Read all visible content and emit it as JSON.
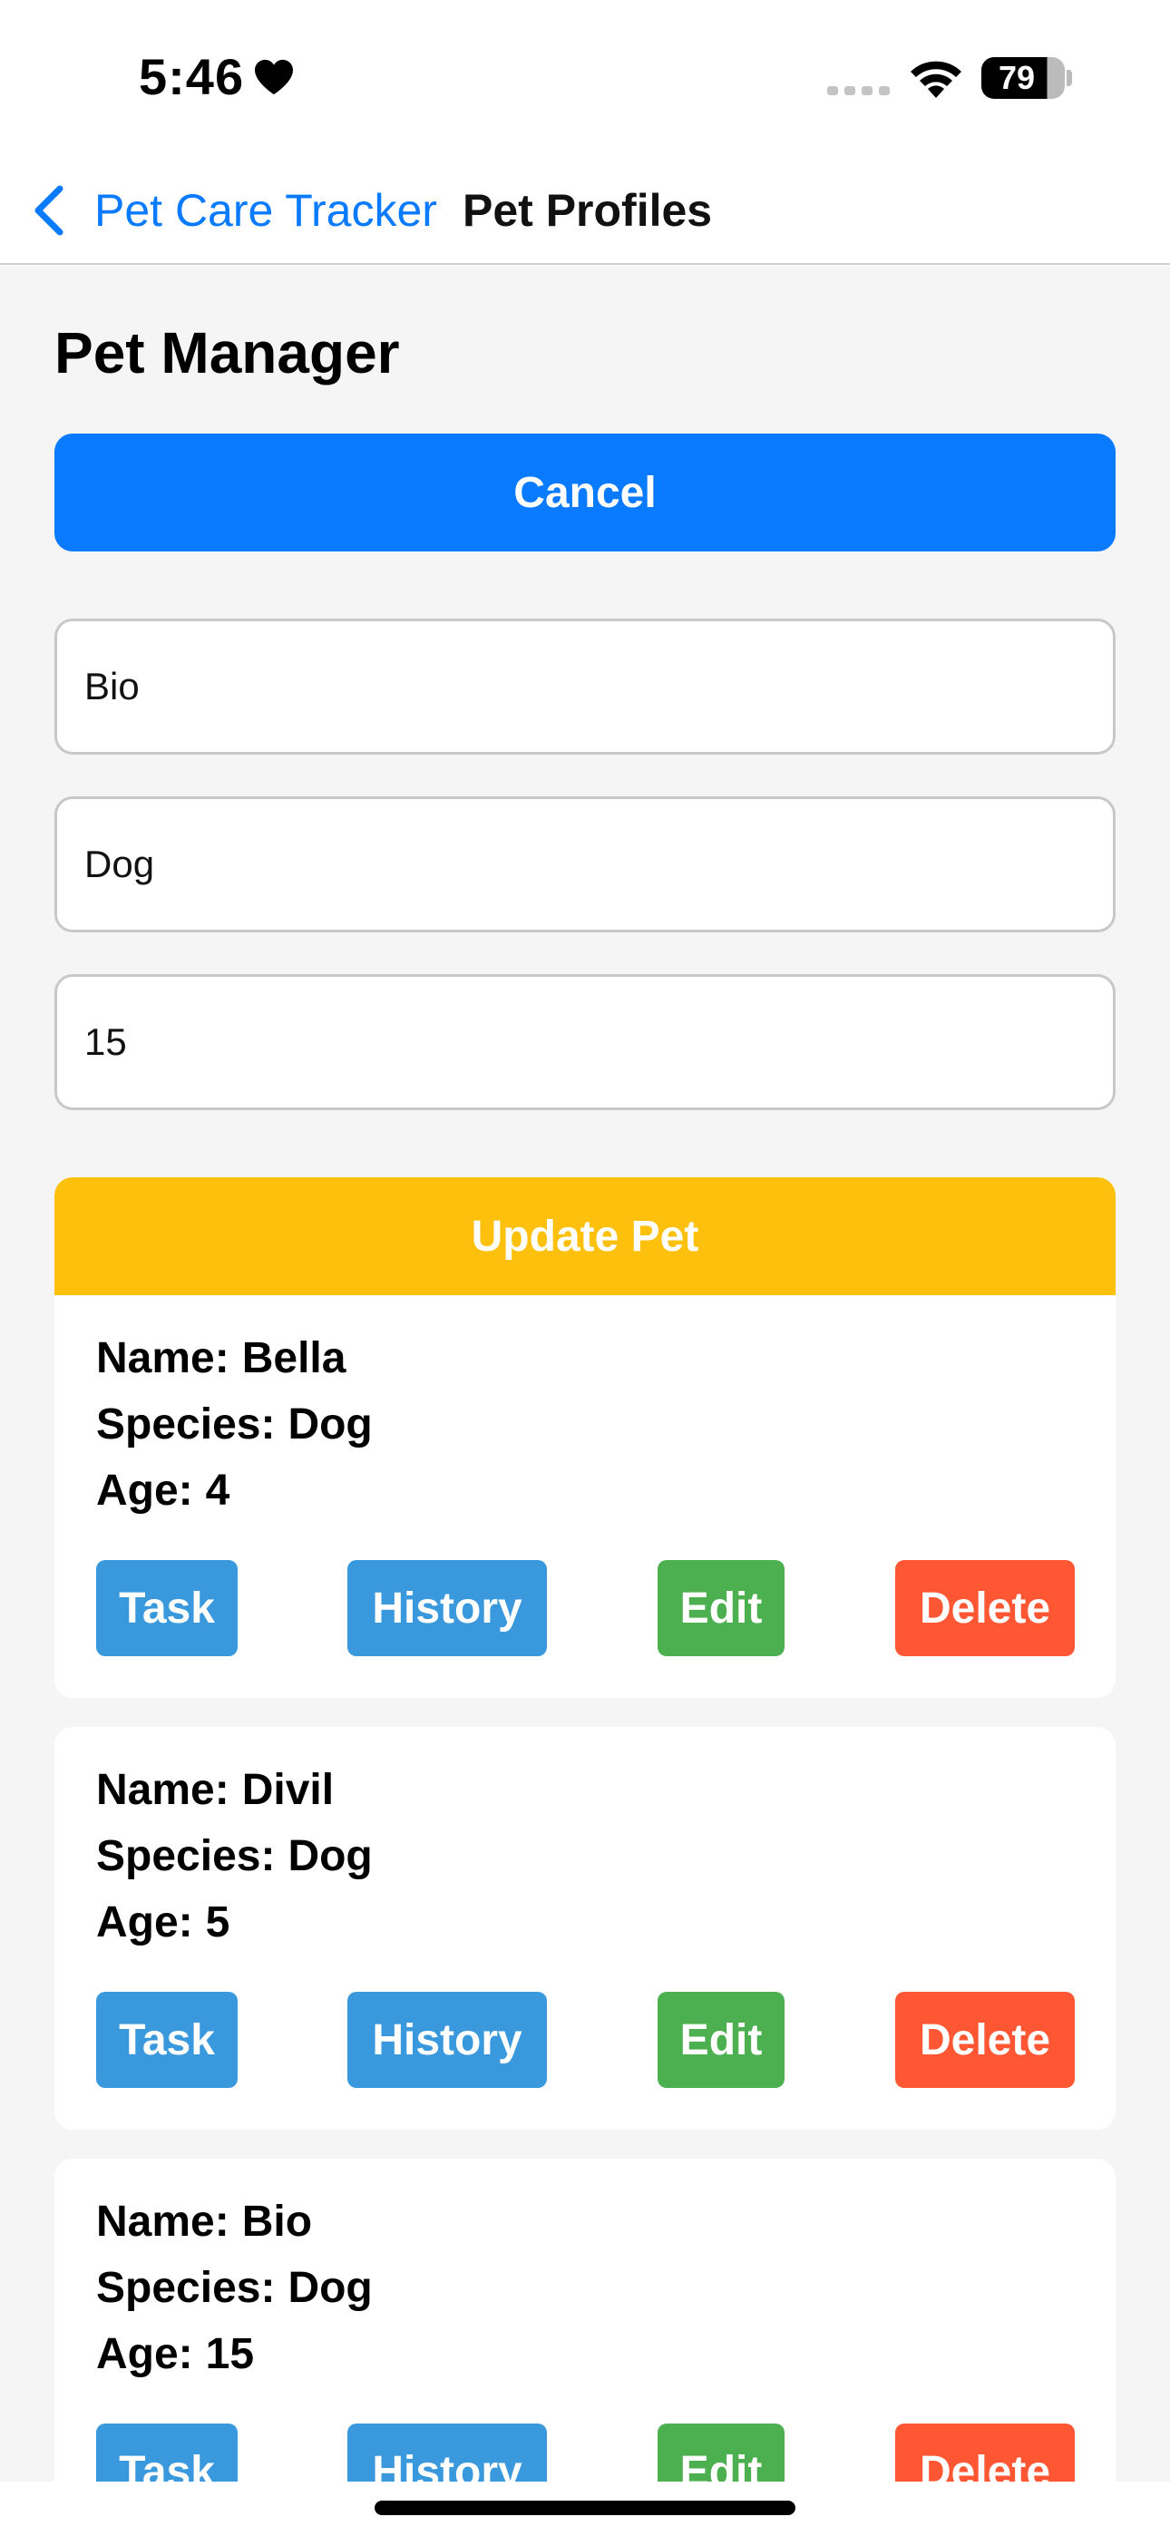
{
  "status_bar": {
    "time": "5:46",
    "battery": "79"
  },
  "nav": {
    "back_label": "Pet Care Tracker",
    "title": "Pet Profiles"
  },
  "page": {
    "title": "Pet Manager",
    "cancel_label": "Cancel",
    "update_label": "Update Pet"
  },
  "form": {
    "name_value": "Bio",
    "species_value": "Dog",
    "age_value": "15"
  },
  "labels": {
    "name": "Name:",
    "species": "Species:",
    "age": "Age:",
    "task": "Task",
    "history": "History",
    "edit": "Edit",
    "delete": "Delete"
  },
  "pets": [
    {
      "name": "Bella",
      "species": "Dog",
      "age": "4"
    },
    {
      "name": "Divil",
      "species": "Dog",
      "age": "5"
    },
    {
      "name": "Bio",
      "species": "Dog",
      "age": "15"
    }
  ],
  "colors": {
    "primary": "#0a7aff",
    "update": "#fcc00d",
    "task_history": "#3a98dc",
    "edit": "#4cb050",
    "delete": "#ff5733"
  }
}
